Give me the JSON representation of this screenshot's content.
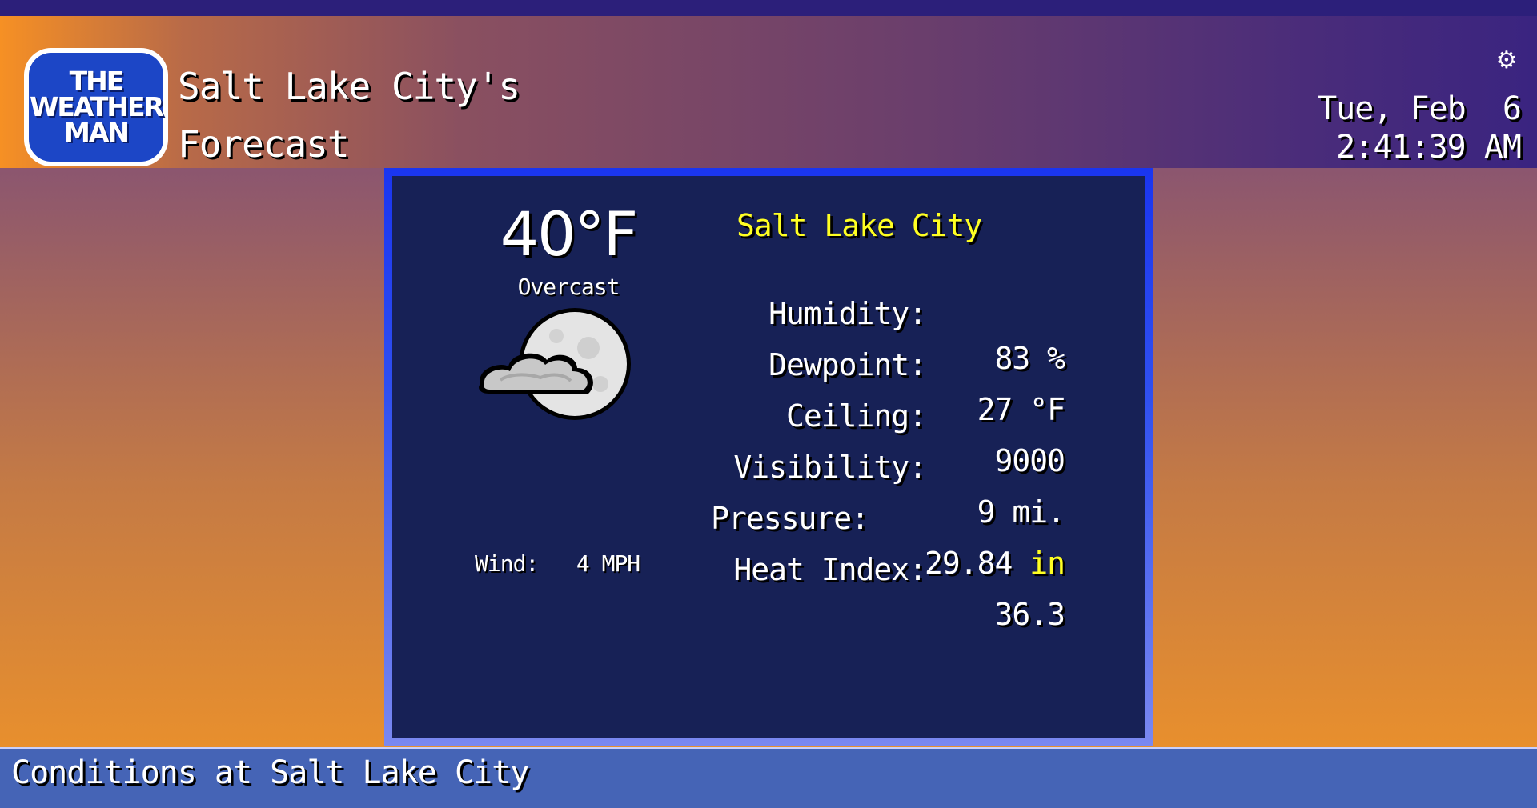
{
  "header": {
    "logo_lines": [
      "THE",
      "WEATHER",
      "MAN"
    ],
    "title_line1": "Salt Lake City's",
    "title_line2": "Forecast",
    "settings_icon": "gear-icon",
    "date": "Tue, Feb  6",
    "time": "2:41:39 AM"
  },
  "current": {
    "temperature": "40°F",
    "condition": "Overcast",
    "icon": "partly-cloudy-night-icon",
    "wind_label": "Wind:",
    "wind_value": "4 MPH",
    "city": "Salt Lake City",
    "details": [
      {
        "label": "Humidity:",
        "value": "83 %"
      },
      {
        "label": "Dewpoint:",
        "value": "27 °F"
      },
      {
        "label": "Ceiling:",
        "value": "9000"
      },
      {
        "label": "Visibility:",
        "value": "9 mi."
      },
      {
        "label": "Pressure:",
        "value": "29.84",
        "unit": "in"
      },
      {
        "label": "Heat Index:",
        "value": "36.3"
      }
    ]
  },
  "footer": {
    "text": "Conditions at Salt Lake City"
  },
  "colors": {
    "panel_bg": "#172156",
    "highlight": "#ffff22",
    "footer_bg": "#4564b6"
  }
}
